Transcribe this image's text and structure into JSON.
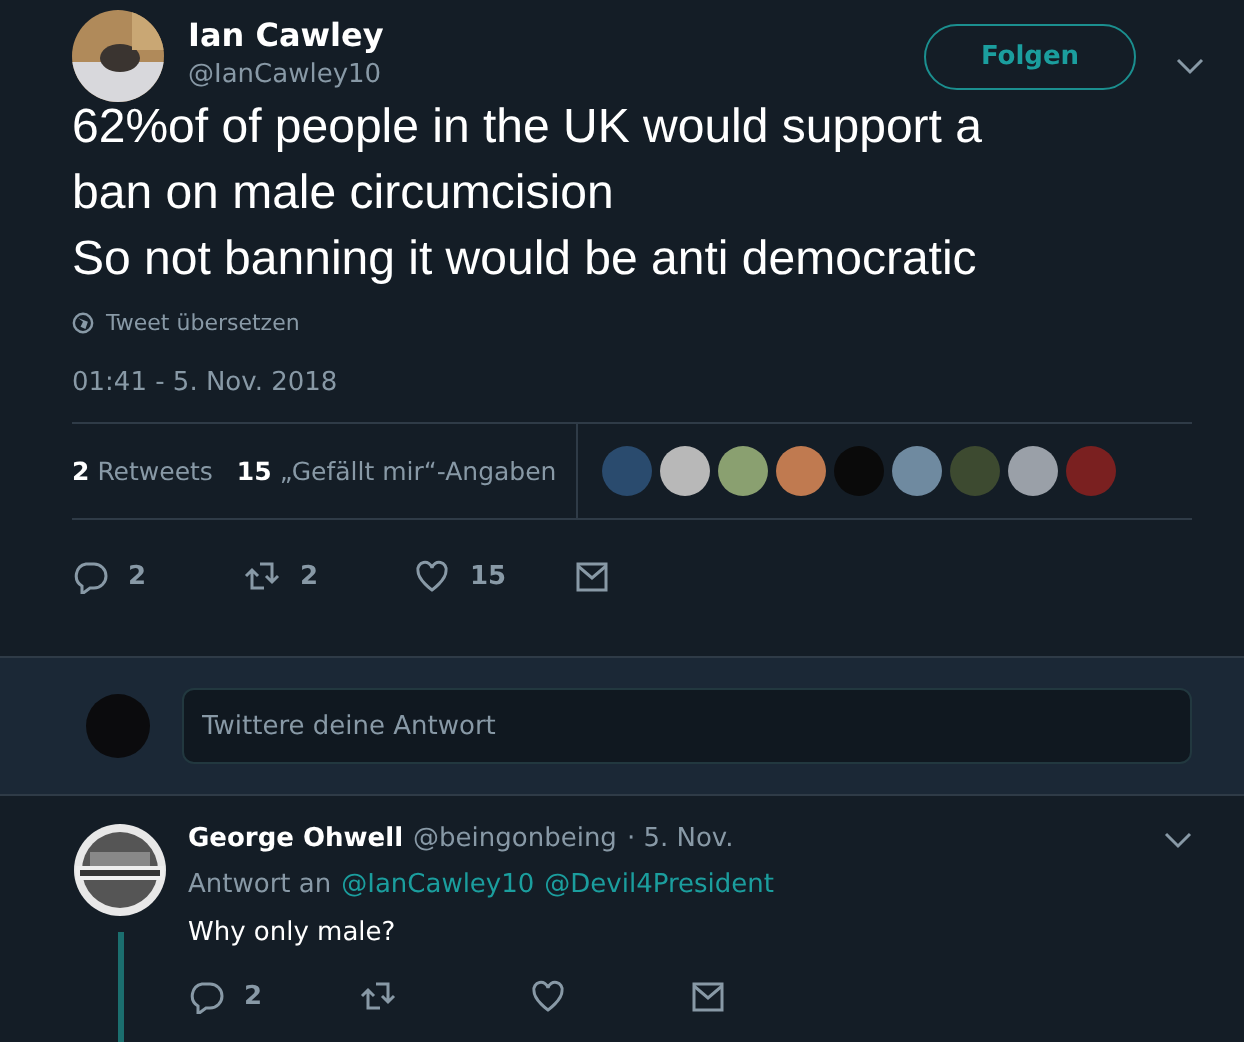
{
  "tweet": {
    "author": {
      "name": "Ian Cawley",
      "handle": "@IanCawley10"
    },
    "follow_button": "Folgen",
    "lines": [
      "62%of of people in the UK would support a",
      "ban on male circumcision",
      "So not banning it would be anti democratic"
    ],
    "translate": "Tweet übersetzen",
    "timestamp": "01:41 - 5. Nov. 2018",
    "stats": [
      {
        "count": "2",
        "label": "Retweets"
      },
      {
        "count": "15",
        "label": "„Gefällt mir“-Angaben"
      }
    ],
    "likers": [
      {
        "color": "#2a4b6e"
      },
      {
        "color": "#b8b8b8"
      },
      {
        "color": "#8aa070"
      },
      {
        "color": "#c07a50"
      },
      {
        "color": "#0a0a0a"
      },
      {
        "color": "#6f8aa0"
      },
      {
        "color": "#3d4a30"
      },
      {
        "color": "#9aa0a8"
      },
      {
        "color": "#7a2020"
      }
    ],
    "actions": [
      {
        "kind": "reply",
        "count": "2"
      },
      {
        "kind": "retweet",
        "count": "2"
      },
      {
        "kind": "like",
        "count": "15"
      },
      {
        "kind": "message"
      }
    ]
  },
  "composer": {
    "placeholder": "Twittere deine Antwort"
  },
  "reply": {
    "name": "George Ohwell",
    "handle": "@beingonbeing",
    "date": "· 5. Nov.",
    "replying_to": "Antwort an",
    "mentions": [
      "@IanCawley10",
      "@Devil4President"
    ],
    "text": "Why only male?",
    "actions": [
      {
        "kind": "reply",
        "count": "2"
      },
      {
        "kind": "retweet"
      },
      {
        "kind": "like"
      },
      {
        "kind": "message"
      }
    ]
  }
}
